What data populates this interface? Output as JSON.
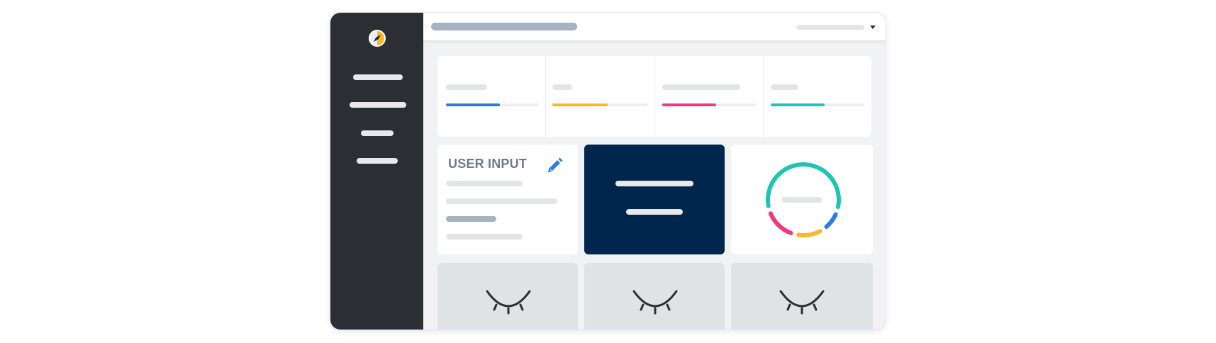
{
  "colors": {
    "sidebar_bg": "#2b2e33",
    "accent_blue": "#2f7be5",
    "accent_yellow": "#fbb72c",
    "accent_pink": "#f13a7d",
    "accent_teal": "#1fc4b4",
    "dark_card": "#00264d",
    "placeholder": "#e2e4e7"
  },
  "sidebar": {
    "logo_icon": "compass-logo-icon",
    "nav_items": 4
  },
  "header": {
    "title_placeholder": true,
    "user_menu_icon": "caret-down-icon"
  },
  "stats": [
    {
      "color": "#2f7be5",
      "progress": 0.58
    },
    {
      "color": "#fbb72c",
      "progress": 0.58
    },
    {
      "color": "#f13a7d",
      "progress": 0.58
    },
    {
      "color": "#1fc4b4",
      "progress": 0.58
    }
  ],
  "user_input_card": {
    "title": "USER INPUT",
    "edit_icon": "pencil-icon"
  },
  "donut": {
    "segments": [
      {
        "color": "#1fc4b4",
        "share": 0.56
      },
      {
        "color": "#2f7be5",
        "share": 0.07
      },
      {
        "color": "#fbb72c",
        "share": 0.1
      },
      {
        "color": "#f13a7d",
        "share": 0.13
      }
    ]
  },
  "bottom_cards": [
    {
      "icon": "closed-eye-icon"
    },
    {
      "icon": "closed-eye-icon"
    },
    {
      "icon": "closed-eye-icon"
    }
  ]
}
